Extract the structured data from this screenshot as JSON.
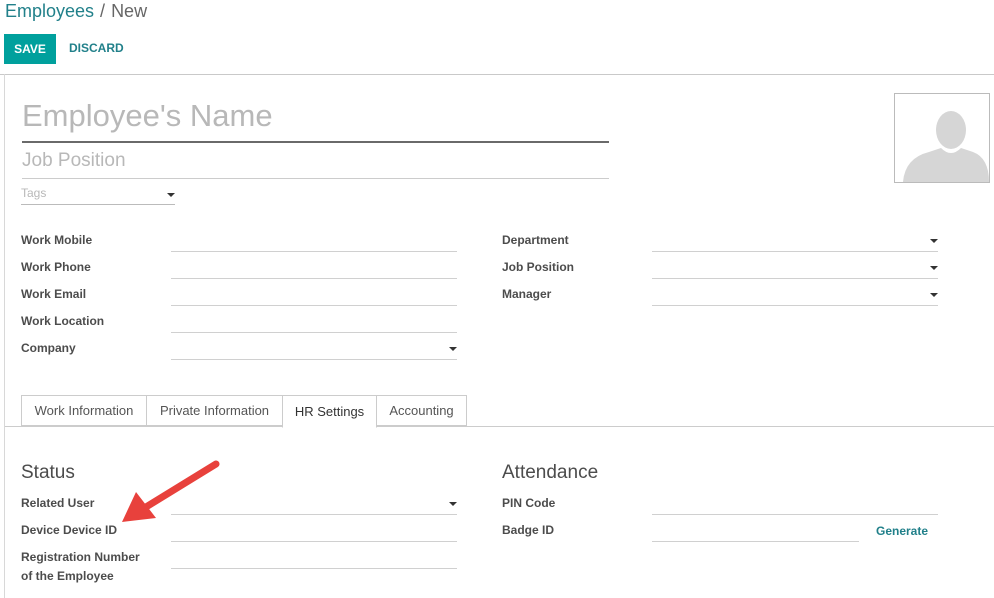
{
  "breadcrumb": {
    "parent": "Employees",
    "separator": "/",
    "current": "New"
  },
  "toolbar": {
    "save_label": "SAVE",
    "discard_label": "DISCARD"
  },
  "form": {
    "name_placeholder": "Employee's Name",
    "job_position_placeholder": "Job Position",
    "tags_placeholder": "Tags"
  },
  "left_fields": {
    "work_mobile": "Work Mobile",
    "work_phone": "Work Phone",
    "work_email": "Work Email",
    "work_location": "Work Location",
    "company": "Company"
  },
  "right_fields": {
    "department": "Department",
    "job_position": "Job Position",
    "manager": "Manager"
  },
  "tabs": [
    {
      "label": "Work Information",
      "active": false
    },
    {
      "label": "Private Information",
      "active": false
    },
    {
      "label": "HR Settings",
      "active": true
    },
    {
      "label": "Accounting",
      "active": false
    }
  ],
  "status": {
    "title": "Status",
    "related_user": "Related User",
    "device_id": "Device Device ID",
    "registration_line1": "Registration Number",
    "registration_line2": "of the Employee"
  },
  "attendance": {
    "title": "Attendance",
    "pin_code": "PIN Code",
    "badge_id": "Badge ID",
    "generate": "Generate"
  },
  "colors": {
    "accent": "#00a09d",
    "link": "#21808a",
    "annotation_arrow": "#e8413c"
  },
  "icons": {
    "photo": "avatar-placeholder-icon",
    "dropdown": "caret-down-icon",
    "annotation": "red-arrow-icon"
  }
}
